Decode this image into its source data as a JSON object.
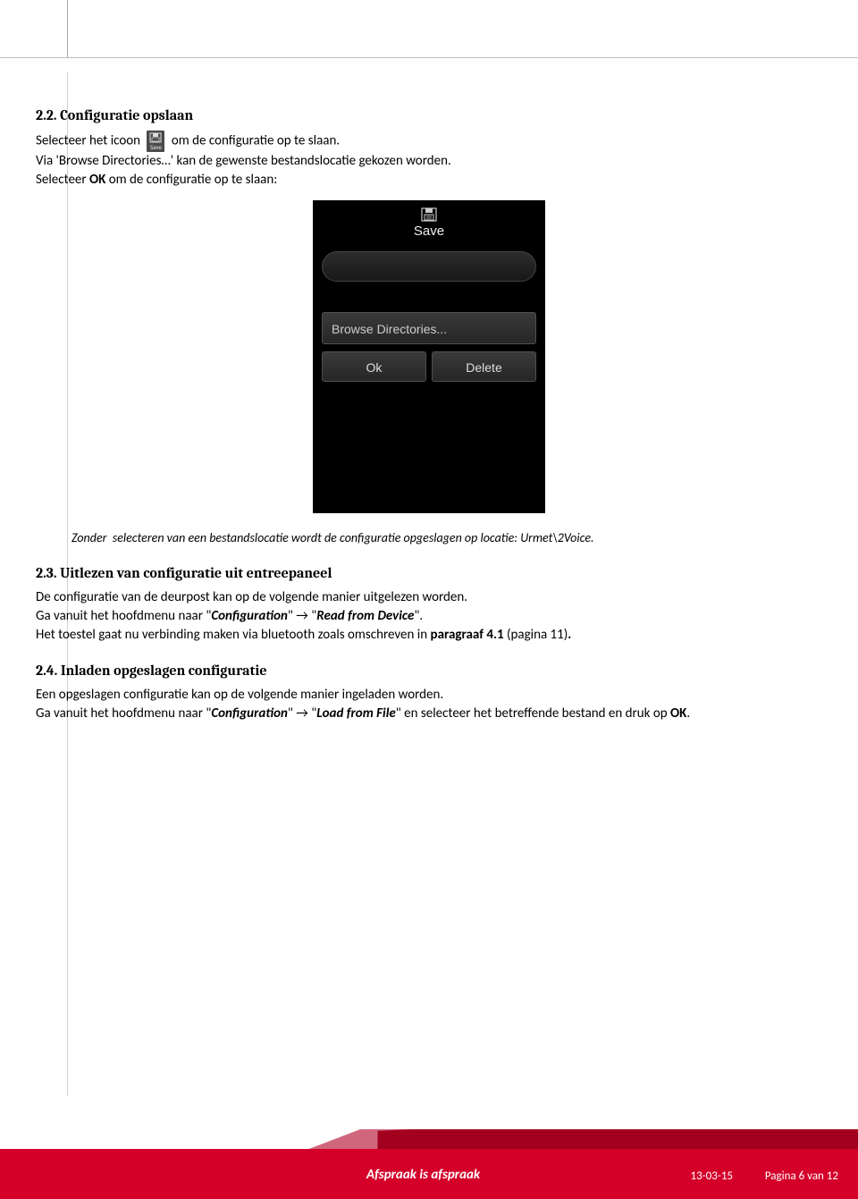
{
  "headings": {
    "s22": "2.2. Configuratie opslaan",
    "s23": "2.3. Uitlezen van configuratie uit entreepaneel",
    "s24": "2.4. Inladen opgeslagen configuratie"
  },
  "body": {
    "s22_line1_a": "Selecteer het icoon ",
    "s22_line1_b": " om de configuratie op te slaan.",
    "s22_line2": "Via 'Browse Directories…' kan de gewenste bestandslocatie gekozen worden.",
    "s22_line3_a": "Selecteer ",
    "s22_line3_ok": "OK",
    "s22_line3_b": " om de configuratie op te slaan:",
    "caption": "Zonder  selecteren van een bestandslocatie wordt de configuratie opgeslagen op locatie: Urmet\\2Voice.",
    "s23_line1": "De configuratie van de deurpost kan op de volgende manier uitgelezen worden.",
    "s23_line2_a": "Ga vanuit het hoofdmenu naar \"",
    "s23_cfg": "Configuration",
    "s23_line2_b": "\" → \"",
    "s23_read": "Read from Device",
    "s23_line2_c": "\".",
    "s23_line3_a": "Het toestel gaat nu verbinding maken via bluetooth zoals omschreven in ",
    "s23_para": "paragraaf 4.1",
    "s23_line3_b": " (pagina 11)",
    "s23_line3_c": ".",
    "s24_line1": "Een opgeslagen configuratie kan op de volgende manier ingeladen worden.",
    "s24_line2_a": "Ga vanuit het hoofdmenu naar \"",
    "s24_cfg": "Configuration",
    "s24_line2_b": "\" → \"",
    "s24_load": "Load from File",
    "s24_line2_c": "\" en selecteer het betreffende bestand en druk op ",
    "s24_ok": "OK",
    "s24_line2_d": "."
  },
  "inline_icon": {
    "label": "Save"
  },
  "phone": {
    "title": "Save",
    "browse": "Browse Directories...",
    "ok": "Ok",
    "delete": "Delete"
  },
  "footer": {
    "slogan": "Afspraak is afspraak",
    "date": "13-03-15",
    "page": "Pagina 6 van 12"
  }
}
